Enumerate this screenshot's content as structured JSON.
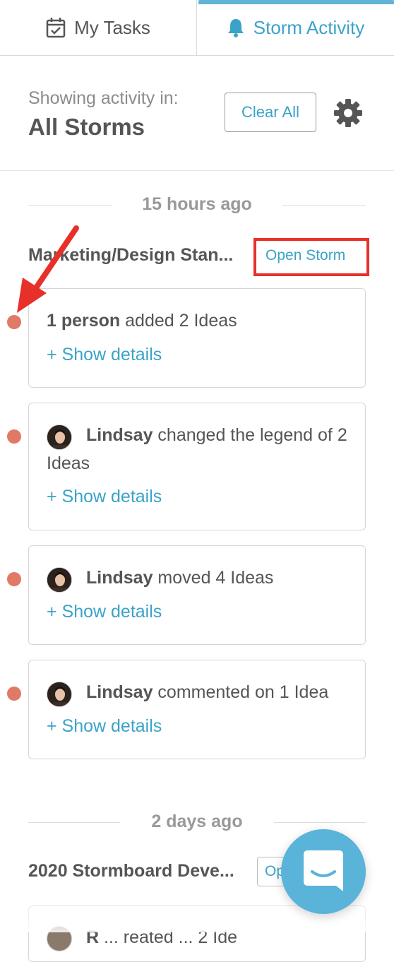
{
  "tabs": {
    "my_tasks": "My Tasks",
    "storm_activity": "Storm Activity"
  },
  "header": {
    "showing_label": "Showing activity in:",
    "scope": "All Storms",
    "clear_all": "Clear All"
  },
  "feed": {
    "sections": [
      {
        "time_label": "15 hours ago",
        "storm_name": "Marketing/Design Stan...",
        "open_label": "Open Storm",
        "events": [
          {
            "actor": "1 person",
            "text": " added 2 Ideas",
            "details": "+ Show details"
          },
          {
            "actor": "Lindsay",
            "text": " changed the legend of 2 Ideas",
            "details": "+ Show details"
          },
          {
            "actor": "Lindsay",
            "text": " moved 4 Ideas",
            "details": "+ Show details"
          },
          {
            "actor": "Lindsay",
            "text": " commented on 1 Idea",
            "details": "+ Show details"
          }
        ]
      },
      {
        "time_label": "2 days ago",
        "storm_name": "2020 Stormboard Deve...",
        "open_label": "Op",
        "events": [
          {
            "actor": "R",
            "text": " ... reated ... 2 Ide"
          }
        ]
      }
    ]
  },
  "icons": {
    "tasks": "calendar-check-icon",
    "activity": "bell-icon",
    "settings": "gear-icon",
    "chat": "chat-bubble-icon"
  },
  "colors": {
    "accent": "#3aa3c8",
    "active_tab_bar": "#62b4d6",
    "unread_dot": "#e07a66",
    "annotation_red": "#e8302a",
    "chat_launcher": "#5ab3d8"
  }
}
